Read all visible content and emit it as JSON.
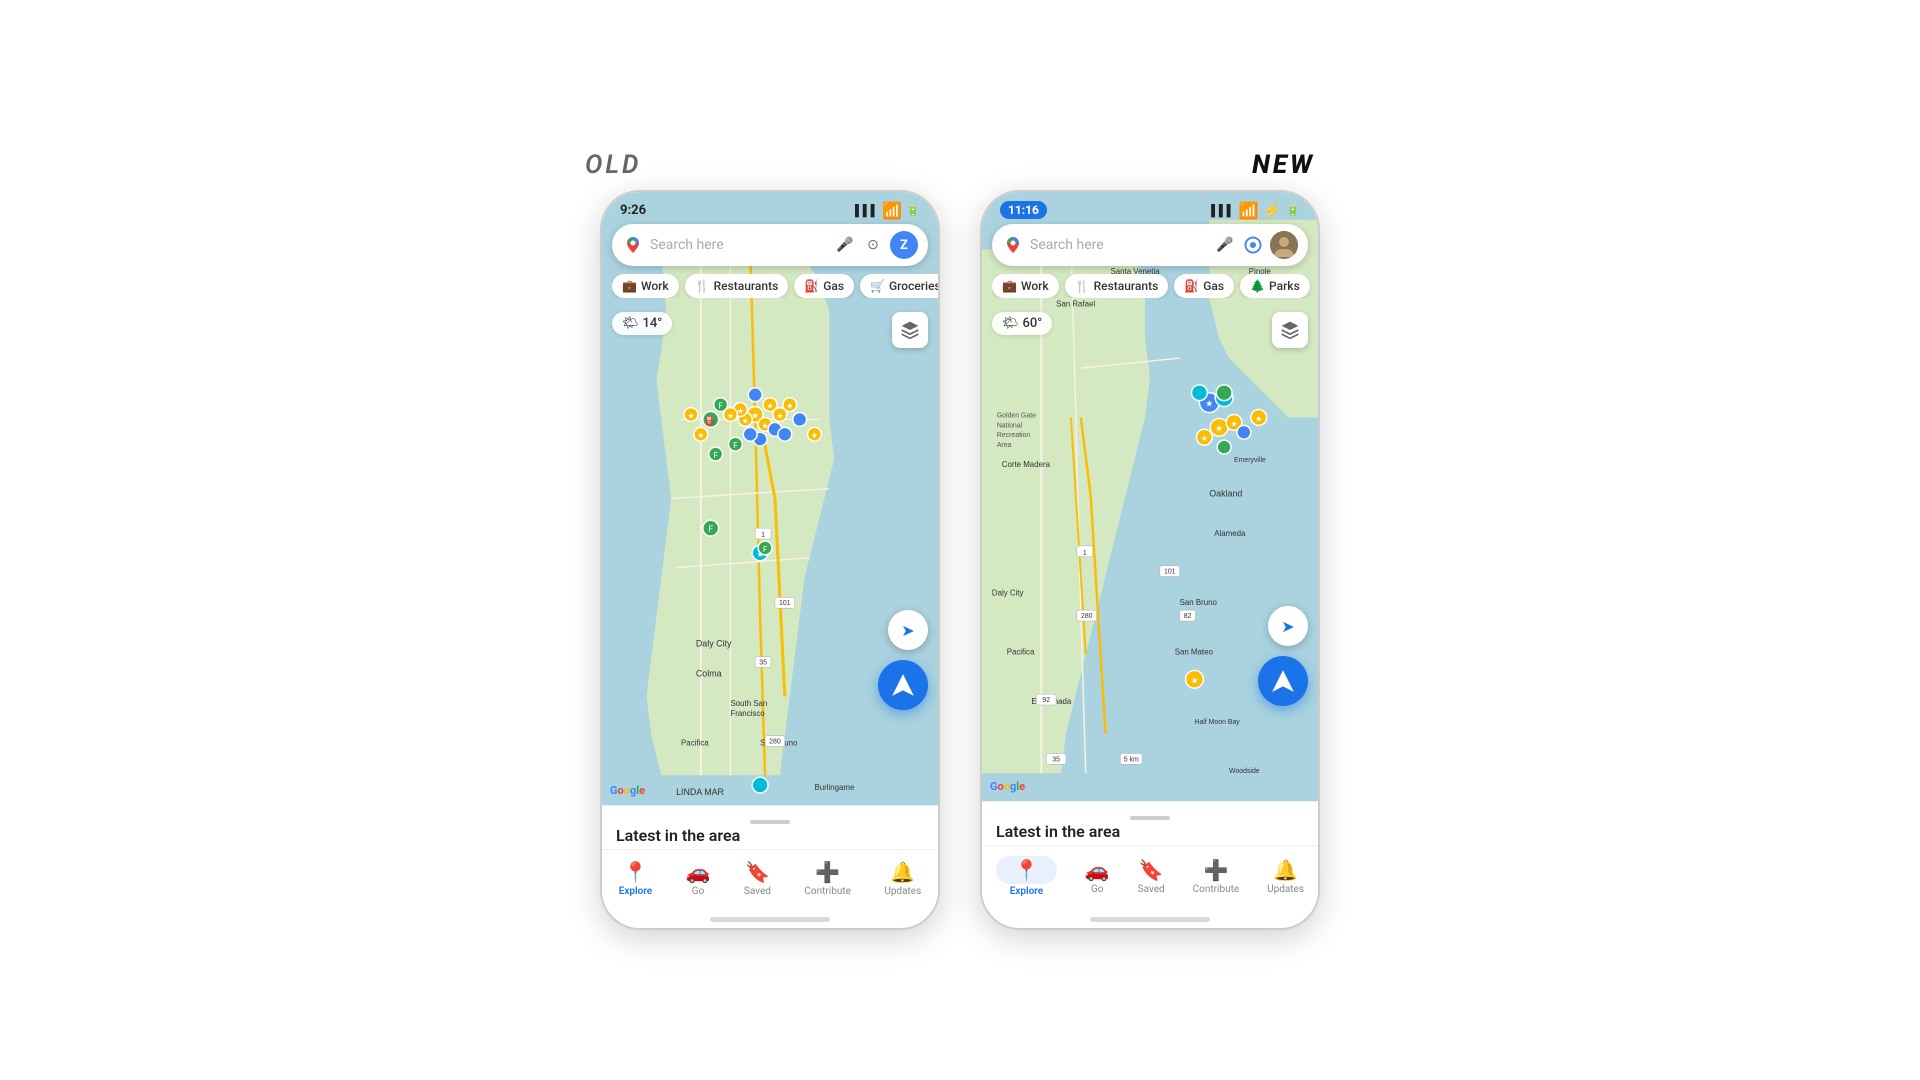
{
  "page": {
    "background": "#ffffff",
    "old_label": "OLD",
    "new_label": "NEW"
  },
  "old_phone": {
    "status_bar": {
      "time": "9:26",
      "signal": "▌▌▌",
      "wifi": "WiFi",
      "battery": "🔋"
    },
    "search": {
      "placeholder": "Search here",
      "has_voice": true,
      "has_lens": true,
      "avatar_letter": "Z"
    },
    "chips": [
      "Work",
      "Restaurants",
      "Gas",
      "Groceries"
    ],
    "chip_icons": [
      "💼",
      "🍴",
      "⛽",
      "🛒"
    ],
    "weather": "14°",
    "weather_icon": "🌤",
    "temperature_unit": "°",
    "nav_items": [
      "Explore",
      "Go",
      "Saved",
      "Contribute",
      "Updates"
    ],
    "nav_icons": [
      "📍",
      "🚗",
      "🔖",
      "➕",
      "🔔"
    ],
    "latest_text": "Latest in the area",
    "google_logo": "Google"
  },
  "new_phone": {
    "status_bar": {
      "time": "11:16",
      "signal": "▌▌▌",
      "wifi": "WiFi",
      "battery": "⚡🔋"
    },
    "search": {
      "placeholder": "Search here",
      "has_voice": true,
      "has_lens": true,
      "has_avatar": true
    },
    "chips": [
      "Work",
      "Restaurants",
      "Gas",
      "Parks"
    ],
    "chip_icons": [
      "💼",
      "🍴",
      "⛽",
      "🌲"
    ],
    "weather": "60°",
    "weather_icon": "🌤",
    "nav_items": [
      "Explore",
      "Go",
      "Saved",
      "Contribute",
      "Updates"
    ],
    "nav_icons": [
      "📍",
      "🚗",
      "🔖",
      "➕",
      "🔔"
    ],
    "latest_text": "Latest in the area",
    "google_logo": "Google"
  }
}
